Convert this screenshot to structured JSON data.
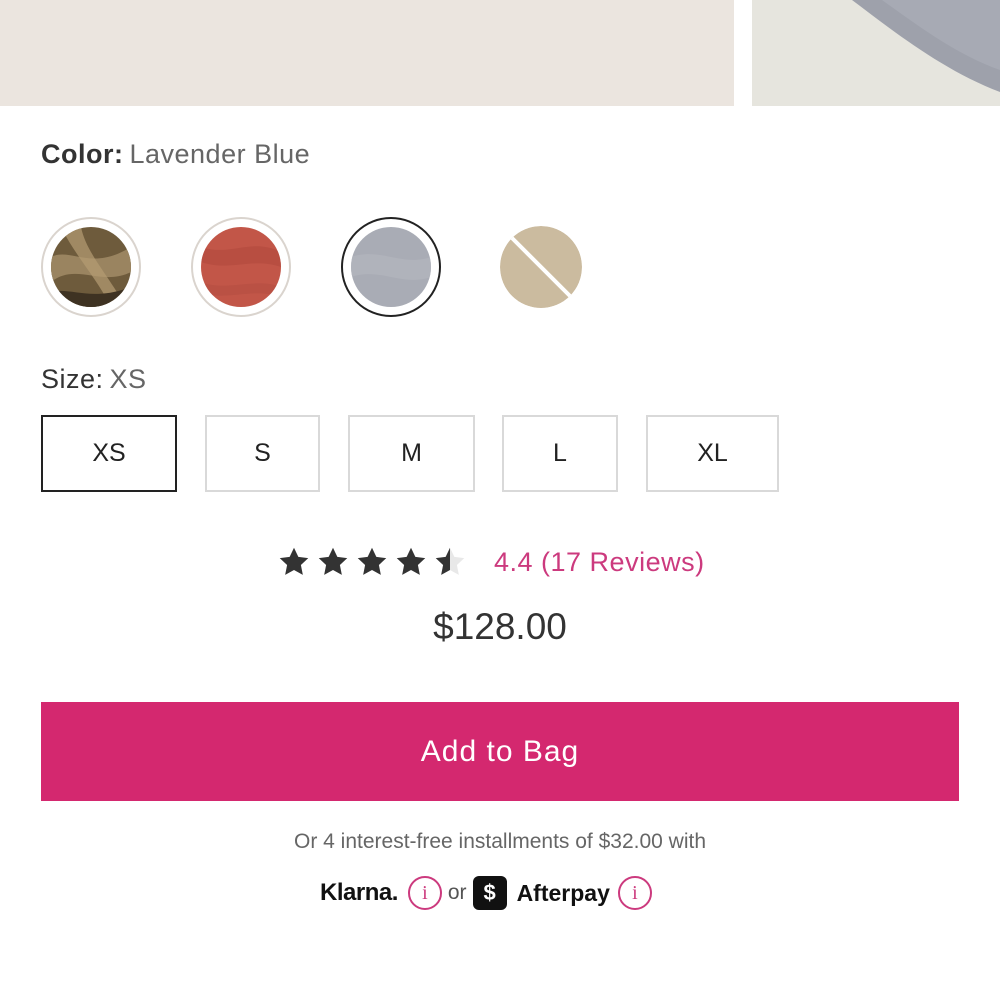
{
  "color": {
    "label": "Color:",
    "selected": "Lavender Blue",
    "swatches": [
      {
        "name": "olive-brown",
        "color": "#7d6a48",
        "selected": false,
        "available": true
      },
      {
        "name": "rust-red",
        "color": "#c25648",
        "selected": false,
        "available": true
      },
      {
        "name": "lavender-blue",
        "color": "#a9acb5",
        "selected": true,
        "available": true
      },
      {
        "name": "sand",
        "color": "#cbbb9f",
        "selected": false,
        "available": false
      }
    ]
  },
  "size": {
    "label": "Size:",
    "selected": "XS",
    "options": [
      "XS",
      "S",
      "M",
      "L",
      "XL"
    ]
  },
  "rating": {
    "value": 4.4,
    "stars_max": 5,
    "text": "4.4 (17 Reviews)",
    "star_color": "#333333",
    "link_color": "#cc3a7e"
  },
  "price": "$128.00",
  "cta": {
    "add_to_bag": "Add to Bag",
    "color": "#d4286f"
  },
  "installments": {
    "text": "Or 4 interest-free installments of $32.00 with",
    "klarna": "Klarna.",
    "or": "or",
    "afterpay_symbol": "$",
    "afterpay": "Afterpay",
    "info_glyph": "i"
  },
  "icons": [
    "star-icon",
    "info-icon",
    "afterpay-icon"
  ]
}
